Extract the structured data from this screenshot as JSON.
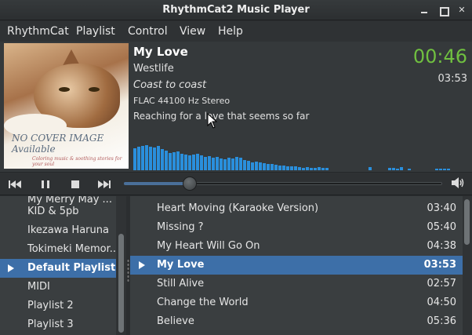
{
  "window": {
    "title": "RhythmCat2 Music Player"
  },
  "menubar": {
    "items": [
      "RhythmCat",
      "Playlist",
      "Control",
      "View",
      "Help"
    ]
  },
  "now_playing": {
    "title": "My Love",
    "artist": "Westlife",
    "album": "Coast to coast",
    "format": "FLAC 44100 Hz Stereo",
    "lyric": "Reaching for a love that seems so far",
    "elapsed": "00:46",
    "duration": "03:53",
    "progress_fraction": 0.197,
    "cover": {
      "line1": "NO COVER IMAGE",
      "line2": "Available",
      "tagline": "Coloring music & soothing stories for your soul"
    }
  },
  "spectrum": {
    "levels": [
      28,
      30,
      31,
      32,
      30,
      29,
      31,
      27,
      25,
      22,
      23,
      24,
      21,
      20,
      19,
      20,
      21,
      19,
      17,
      18,
      16,
      17,
      15,
      14,
      16,
      15,
      17,
      16,
      13,
      12,
      10,
      11,
      10,
      9,
      8,
      8,
      7,
      6,
      6,
      5,
      5,
      5,
      4,
      3,
      4,
      3,
      3,
      4,
      3,
      3,
      0,
      0,
      0,
      0,
      0,
      0,
      0,
      0,
      0,
      0,
      4,
      0,
      0,
      0,
      0,
      3,
      3,
      2,
      4,
      0,
      2,
      0,
      0,
      0,
      0,
      0,
      0,
      2,
      2,
      2,
      2
    ],
    "color": "#2a8fdc"
  },
  "controls": {
    "icons": [
      "previous-icon",
      "pause-icon",
      "stop-icon",
      "next-icon",
      "volume-icon"
    ]
  },
  "sidebar": {
    "items": [
      {
        "label": "My Merry May ..."
      },
      {
        "label": "KID & 5pb"
      },
      {
        "label": "Ikezawa Haruna"
      },
      {
        "label": "Tokimeki Memor..."
      },
      {
        "label": "Default Playlist",
        "selected": true
      },
      {
        "label": "MIDI"
      },
      {
        "label": "Playlist 2"
      },
      {
        "label": "Playlist 3"
      }
    ]
  },
  "tracks": [
    {
      "name": "Heart Moving (Karaoke Version)",
      "duration": "03:40"
    },
    {
      "name": "Missing ?",
      "duration": "05:40"
    },
    {
      "name": "My Heart Will Go On",
      "duration": "04:38"
    },
    {
      "name": "My Love",
      "duration": "03:53",
      "playing": true
    },
    {
      "name": "Still Alive",
      "duration": "02:57"
    },
    {
      "name": "Change the World",
      "duration": "04:50"
    },
    {
      "name": "Believe",
      "duration": "05:36"
    }
  ],
  "colors": {
    "accent": "#3d6fa8",
    "elapsed": "#70c040"
  }
}
